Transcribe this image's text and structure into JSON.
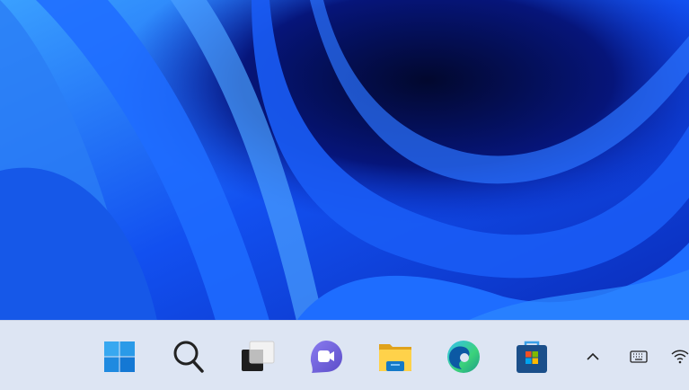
{
  "desktop": {
    "wallpaper": "windows-11-bloom-blue"
  },
  "taskbar": {
    "pinned": [
      {
        "id": "start",
        "icon": "windows-start-icon"
      },
      {
        "id": "search",
        "icon": "search-icon"
      },
      {
        "id": "task-view",
        "icon": "task-view-icon"
      },
      {
        "id": "teams-chat",
        "icon": "video-chat-icon"
      },
      {
        "id": "file-explorer",
        "icon": "folder-icon"
      },
      {
        "id": "edge",
        "icon": "edge-browser-icon"
      },
      {
        "id": "store",
        "icon": "store-bag-icon"
      }
    ],
    "tray": [
      {
        "id": "show-hidden",
        "icon": "chevron-up-icon"
      },
      {
        "id": "touch-keyboard",
        "icon": "keyboard-icon"
      },
      {
        "id": "network",
        "icon": "wifi-icon"
      }
    ],
    "colors": {
      "background": "#dde5f3",
      "accent": "#0f6cbd"
    }
  }
}
